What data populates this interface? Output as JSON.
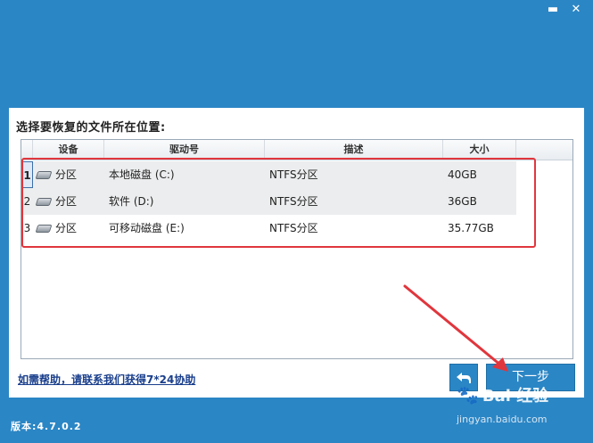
{
  "window": {
    "minimize_label": "▬",
    "close_label": "✕"
  },
  "prompt_text": "选择要恢复的文件所在位置:",
  "table": {
    "headers": [
      "",
      "设备",
      "驱动号",
      "描述",
      "大小",
      ""
    ],
    "rows": [
      {
        "index": "1",
        "device": "分区",
        "drive": "本地磁盘 (C:)",
        "description": "NTFS分区",
        "size": "40GB"
      },
      {
        "index": "2",
        "device": "分区",
        "drive": "软件 (D:)",
        "description": "NTFS分区",
        "size": "36GB"
      },
      {
        "index": "3",
        "device": "分区",
        "drive": "可移动磁盘 (E:)",
        "description": "NTFS分区",
        "size": "35.77GB"
      }
    ]
  },
  "help_link": "如需帮助，请联系我们获得7*24协助",
  "buttons": {
    "back_icon": "back-arrow-icon",
    "next_label": "下一步"
  },
  "version_text": "版本:4.7.0.2",
  "watermark": {
    "brand": "Bai 经验",
    "url": "jingyan.baidu.com"
  },
  "colors": {
    "background": "#2b86c5",
    "highlight": "#e0363d",
    "link": "#1a3f8c"
  }
}
